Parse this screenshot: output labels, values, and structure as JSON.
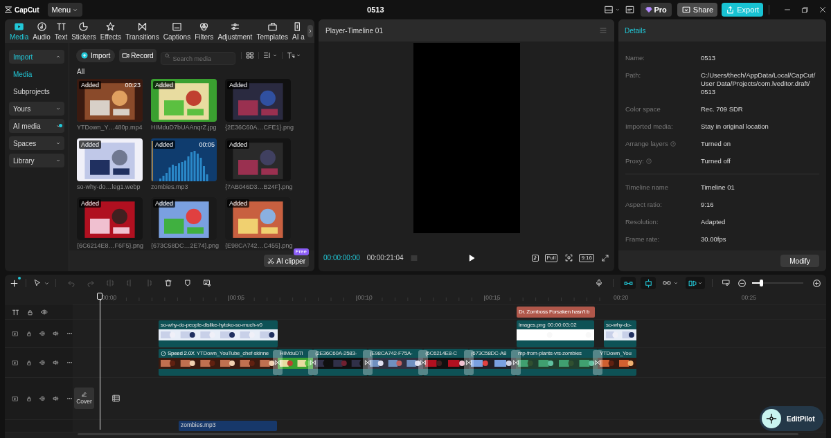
{
  "app": {
    "logo": "CapCut",
    "menu": "Menu",
    "title": "0513",
    "pro": "Pro",
    "share": "Share",
    "export": "Export"
  },
  "tabs": [
    {
      "label": "Media",
      "selected": true
    },
    {
      "label": "Audio",
      "selected": false
    },
    {
      "label": "Text",
      "selected": false
    },
    {
      "label": "Stickers",
      "selected": false
    },
    {
      "label": "Effects",
      "selected": false
    },
    {
      "label": "Transitions",
      "selected": false
    },
    {
      "label": "Captions",
      "selected": false
    },
    {
      "label": "Filters",
      "selected": false
    },
    {
      "label": "Adjustment",
      "selected": false
    },
    {
      "label": "Templates",
      "selected": false
    },
    {
      "label": "AI a",
      "selected": false
    }
  ],
  "sidebar": [
    {
      "label": "Import",
      "kind": "group",
      "expanded": true,
      "selected": true
    },
    {
      "label": "Media",
      "kind": "item",
      "selected": true
    },
    {
      "label": "Subprojects",
      "kind": "item",
      "selected": false
    },
    {
      "label": "Yours",
      "kind": "group",
      "expanded": false,
      "selected": false
    },
    {
      "label": "AI media",
      "kind": "group",
      "expanded": false,
      "selected": false,
      "new_dot": true
    },
    {
      "label": "Spaces",
      "kind": "group",
      "expanded": false,
      "selected": false
    },
    {
      "label": "Library",
      "kind": "group",
      "expanded": false,
      "selected": false
    }
  ],
  "media": {
    "import": "Import",
    "record": "Record",
    "search": {
      "placeholder": "Search media"
    },
    "section": "All",
    "items": [
      {
        "name": "YTDown_Y…480p.mp4",
        "badge": "Added",
        "duration": "00:23"
      },
      {
        "name": "HIMduD7bUAAnqrZ.jpg",
        "badge": "Added"
      },
      {
        "name": "{2E36C60A…CFE1}.png",
        "badge": "Added"
      },
      {
        "name": "so-why-do…leg1.webp",
        "badge": "Added"
      },
      {
        "name": "zombies.mp3",
        "badge": "Added",
        "duration": "00:05",
        "kind": "audio"
      },
      {
        "name": "{7AB046D3…B24F}.png",
        "badge": "Added"
      },
      {
        "name": "{6C6214E8…F6F5}.png",
        "badge": "Added"
      },
      {
        "name": "{673C58DC…2E74}.png",
        "badge": "Added"
      },
      {
        "name": "{E98CA742…C455}.png",
        "badge": "Added"
      }
    ],
    "ai_clipper": {
      "label": "AI clipper",
      "badge": "Free"
    }
  },
  "player": {
    "title": "Player-Timeline 01",
    "current": "00:00:00:00",
    "total": "00:00:21:04",
    "full": "Full",
    "ratio": "9:16"
  },
  "details": {
    "title": "Details",
    "sections": [
      [
        {
          "label": "Name:",
          "value": "0513"
        },
        {
          "label": "Path:",
          "value": "C:/Users/thech/AppData/Local/CapCut/ User Data/Projects/com.lveditor.draft/ 0513"
        },
        {
          "label": "Color space",
          "value": "Rec. 709 SDR"
        },
        {
          "label": "Imported media:",
          "value": "Stay in original location"
        },
        {
          "label": "Arrange layers",
          "value": "Turned on",
          "help": true
        },
        {
          "label": "Proxy:",
          "value": "Turned off",
          "help": true
        }
      ],
      [
        {
          "label": "Timeline name",
          "value": "Timeline 01"
        },
        {
          "label": "Aspect ratio:",
          "value": "9:16"
        },
        {
          "label": "Resolution:",
          "value": "Adapted"
        },
        {
          "label": "Frame rate:",
          "value": "30.00fps"
        }
      ]
    ],
    "modify": "Modify"
  },
  "timeline": {
    "ruler": [
      "00:00",
      "00:05",
      "00:10",
      "00:15",
      "00:20",
      "00:25"
    ],
    "zoom": {
      "level": 0.18
    },
    "tracks": [
      {
        "kind": "text",
        "clips": [
          {
            "label": "Dr. Zomboss Forsaken hasn't b"
          }
        ]
      },
      {
        "kind": "video",
        "clips": [
          {
            "label": "so-why-do-people-dislike-hytoko-so-much-v0"
          },
          {
            "label": "images.png",
            "duration": "00:00:03:02"
          },
          {
            "label": "so-why-do-"
          }
        ]
      },
      {
        "kind": "video",
        "clips": [
          {
            "speed": "Speed 2.0X",
            "label": "YTDown_YouTube_chef-skinne"
          },
          {
            "label": "HIMduD7l",
            "transition": true
          },
          {
            "label": "{2E36C60A-2583-",
            "transition": true
          },
          {
            "label": "{E98CA742-F75A-",
            "transition": true
          },
          {
            "label": "{6C6214E8-C",
            "transition": true
          },
          {
            "label": "{673C58DC-A8",
            "transition": true
          },
          {
            "label": "mp-from-plants-vrs-zombies",
            "transition": true
          },
          {
            "label": "YTDown_You",
            "transition": true
          }
        ]
      },
      {
        "kind": "video",
        "cover": "Cover"
      },
      {
        "kind": "audio",
        "clips": [
          {
            "label": "zombies.mp3"
          }
        ]
      }
    ]
  },
  "editpilot": "EditPilot"
}
